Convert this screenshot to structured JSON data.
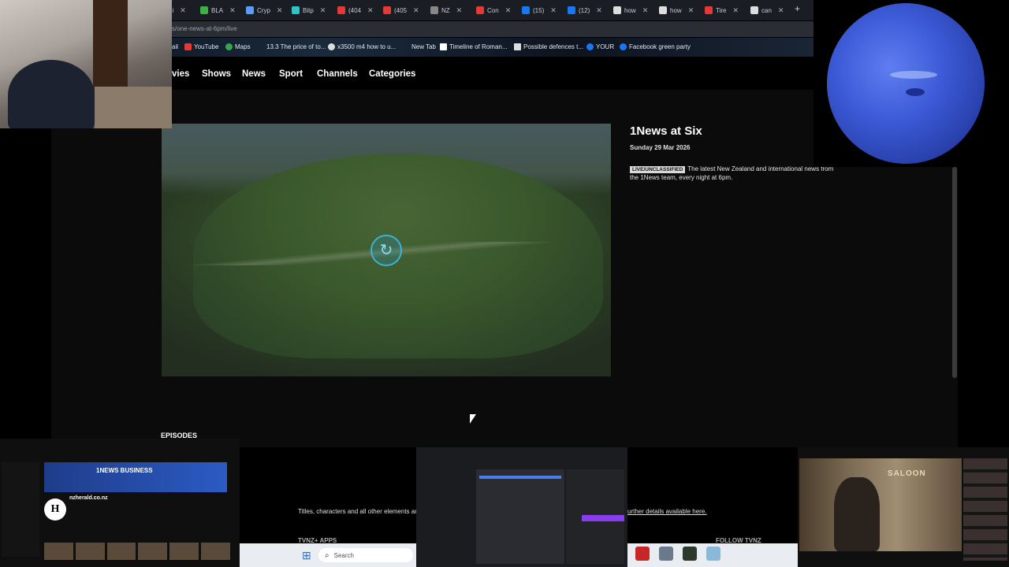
{
  "browser": {
    "tabs": [
      {
        "label": "gi",
        "color": "#e0e0e0"
      },
      {
        "label": "BLA",
        "color": "#3cb043"
      },
      {
        "label": "Cryp",
        "color": "#5a9cf8"
      },
      {
        "label": "Bitp",
        "color": "#2ec4c4"
      },
      {
        "label": "(404",
        "color": "#e53935"
      },
      {
        "label": "(405",
        "color": "#e53935"
      },
      {
        "label": "NZ",
        "color": "#888888"
      },
      {
        "label": "Con",
        "color": "#e53935"
      },
      {
        "label": "(15)",
        "color": "#1877f2"
      },
      {
        "label": "(12)",
        "color": "#1877f2"
      },
      {
        "label": "how",
        "color": "#dddddd"
      },
      {
        "label": "how",
        "color": "#dddddd"
      },
      {
        "label": "Tire",
        "color": "#e53935"
      },
      {
        "label": "can",
        "color": "#dddddd"
      }
    ],
    "new_tab": "+",
    "url": "s/one-news-at-6pm/live",
    "bookmarks": [
      "ail",
      "YouTube",
      "Maps",
      "13.3 The price of to...",
      "x3500 m4 how to u...",
      "New Tab",
      "Timeline of Roman...",
      "Possible defences t...",
      "YOUR",
      "Facebook green party"
    ]
  },
  "site": {
    "nav": [
      "vies",
      "Shows",
      "News",
      "Sport",
      "Channels",
      "Categories"
    ],
    "show": {
      "title": "1News at Six",
      "date": "Sunday 29 Mar 2026",
      "badge": "LIVE/UNCLASSIFIED",
      "description": "The latest New Zealand and international news from the 1News team, every night at 6pm."
    },
    "episodes_label": "EPISODES",
    "footer": {
      "disclaimer": "Titles, characters and all other elements are",
      "further_link": "urther details available here.",
      "apps_label": "TVNZ+ APPS",
      "follow_label": "FOLLOW TVNZ"
    }
  },
  "taskbar": {
    "search_placeholder": "Search",
    "preview_youtube": {
      "banner": "1NEWS BUSINESS",
      "channel": "nzherald.co.nz",
      "logo": "H"
    },
    "preview_video": {
      "sign": "SALOON"
    }
  },
  "colors": {
    "accent": "#3bb2d6",
    "planet": "#3c5ad6"
  }
}
